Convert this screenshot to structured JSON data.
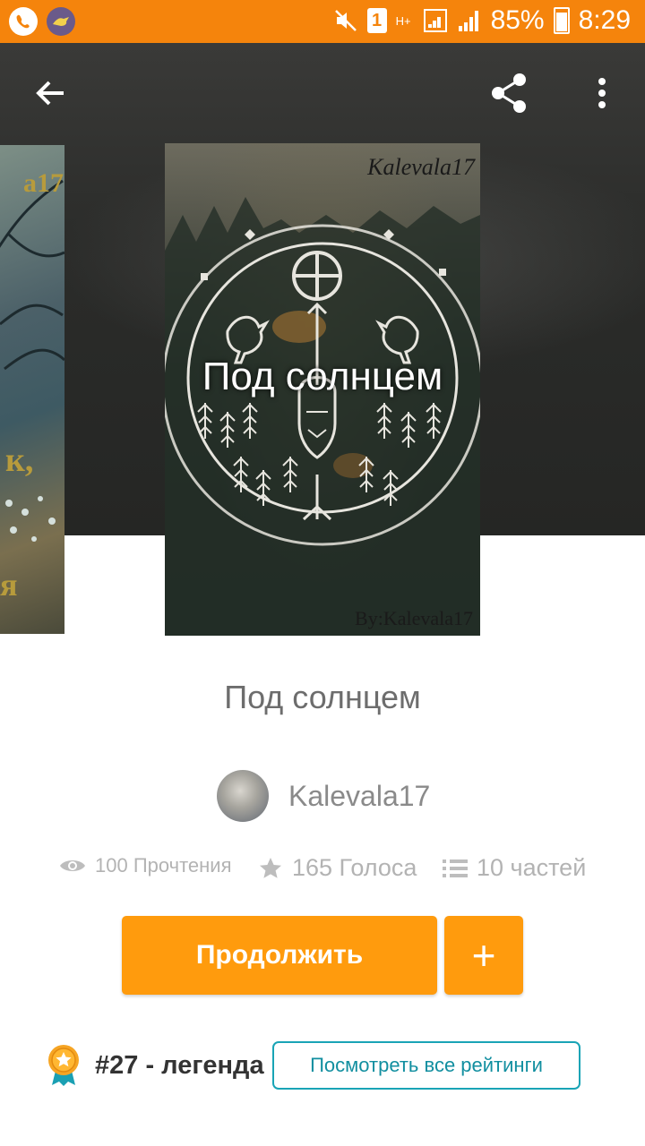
{
  "status_bar": {
    "battery": "85%",
    "time": "8:29",
    "sim": "1",
    "network": "H+"
  },
  "story": {
    "title": "Под солнцем",
    "cover_title": "Под солнцем",
    "cover_signature": "Kalevala17",
    "cover_byline": "By:Kalevala17",
    "author": "Kalevala17",
    "reads": "100 Прочтения",
    "votes": "165 Голоса",
    "parts": "10 частей"
  },
  "actions": {
    "continue_label": "Продолжить",
    "add_label": "+"
  },
  "ranking": {
    "text": "#27 - легенда",
    "view_all_label": "Посмотреть все рейтинги"
  },
  "colors": {
    "status_bar": "#f5840c",
    "accent": "#ff9b0d",
    "link": "#19a4b6"
  }
}
